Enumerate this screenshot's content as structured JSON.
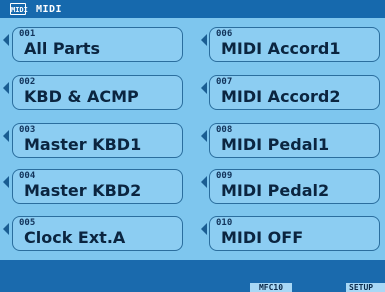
{
  "title_bar": {
    "icon_label": "MIDI",
    "title": "MIDI"
  },
  "left_column": [
    {
      "number": "001",
      "label": "All Parts"
    },
    {
      "number": "002",
      "label": "KBD & ACMP"
    },
    {
      "number": "003",
      "label": "Master KBD1"
    },
    {
      "number": "004",
      "label": "Master KBD2"
    },
    {
      "number": "005",
      "label": "Clock Ext.A"
    }
  ],
  "right_column": [
    {
      "number": "006",
      "label": "MIDI Accord1"
    },
    {
      "number": "007",
      "label": "MIDI Accord2"
    },
    {
      "number": "008",
      "label": "MIDI Pedal1"
    },
    {
      "number": "009",
      "label": "MIDI Pedal2"
    },
    {
      "number": "010",
      "label": "MIDI OFF"
    }
  ],
  "bottom_tabs": {
    "mfc10": "MFC10",
    "setup": "SETUP"
  },
  "colors": {
    "background": "#7ec6ee",
    "title_bar": "#1669ad",
    "button_fill": "#8ccdf2",
    "button_border": "#2b6e9e",
    "text": "#0b2540"
  }
}
